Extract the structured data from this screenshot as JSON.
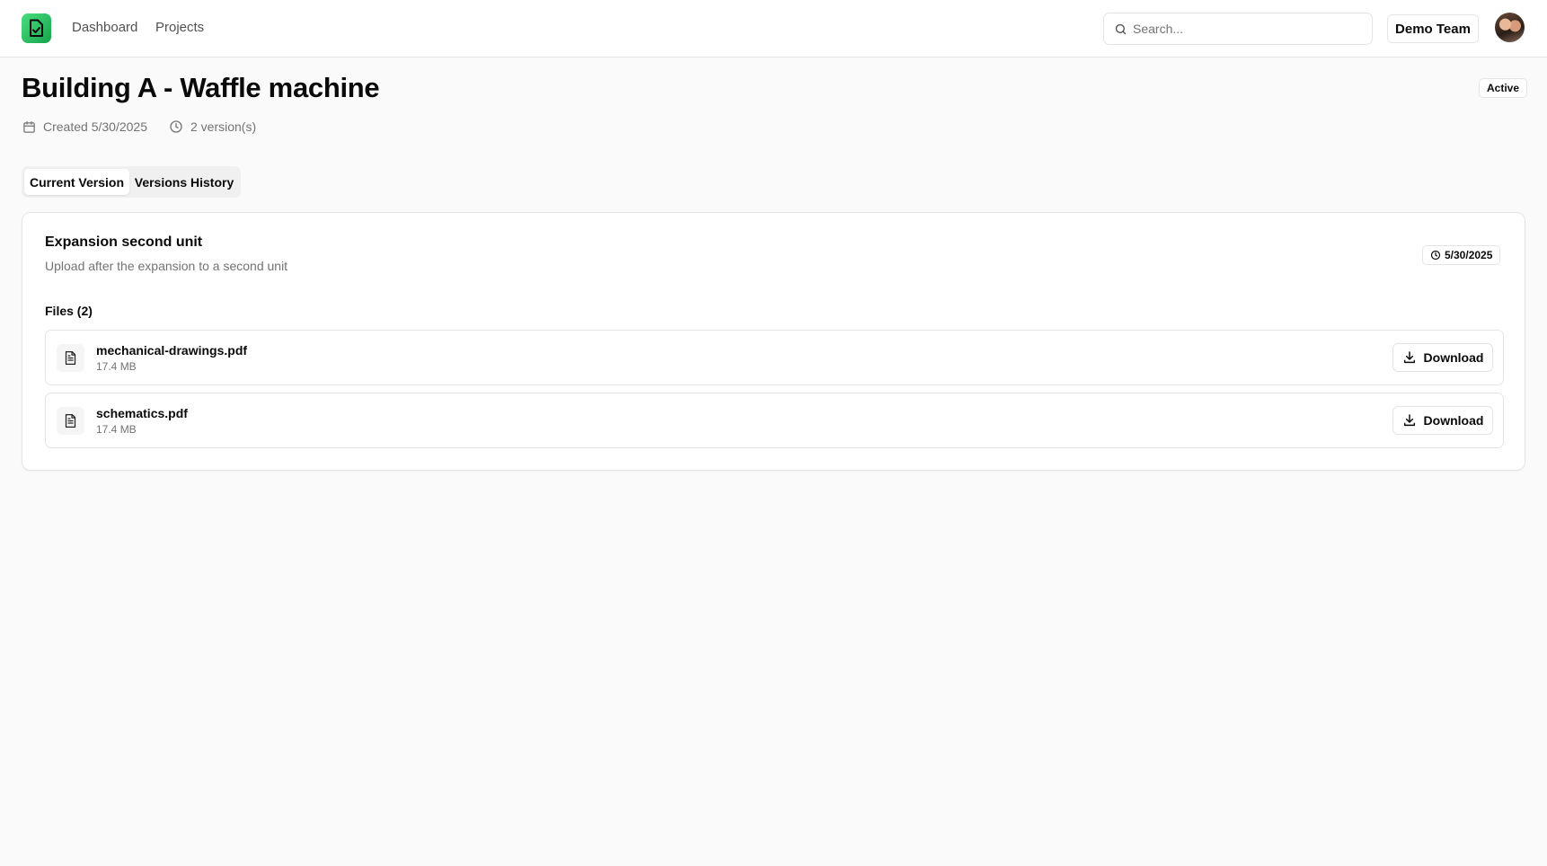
{
  "header": {
    "logo_icon": "document-check-icon",
    "brand_color": "#22c55e",
    "nav": [
      {
        "label": "Dashboard"
      },
      {
        "label": "Projects"
      }
    ],
    "search": {
      "placeholder": "Search...",
      "value": ""
    },
    "team_label": "Demo Team"
  },
  "project": {
    "title": "Building A - Waffle machine",
    "status": "Active",
    "created": "Created 5/30/2025",
    "versions": "2 version(s)"
  },
  "tabs": [
    {
      "label": "Current Version",
      "active": true
    },
    {
      "label": "Versions History",
      "active": false
    }
  ],
  "current_version": {
    "title": "Expansion second unit",
    "description": "Upload after the expansion to a second unit",
    "date": "5/30/2025",
    "files_heading": "Files (2)",
    "files": [
      {
        "name": "mechanical-drawings.pdf",
        "size": "17.4 MB",
        "action": "Download"
      },
      {
        "name": "schematics.pdf",
        "size": "17.4 MB",
        "action": "Download"
      }
    ]
  }
}
